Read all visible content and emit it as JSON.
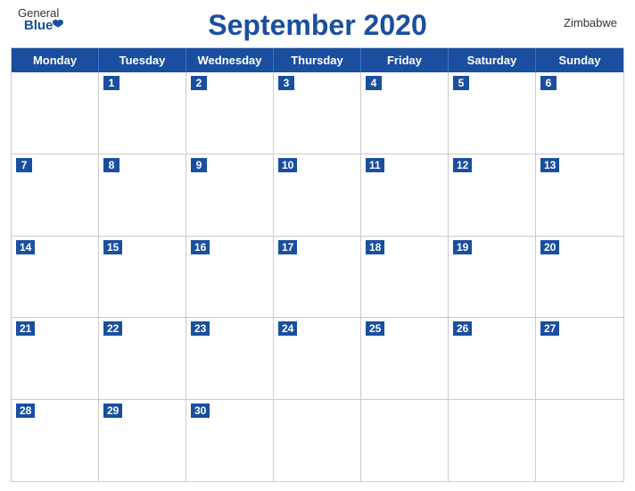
{
  "header": {
    "title": "September 2020",
    "logo_general": "General",
    "logo_blue": "Blue",
    "country": "Zimbabwe"
  },
  "days": {
    "headers": [
      "Monday",
      "Tuesday",
      "Wednesday",
      "Thursday",
      "Friday",
      "Saturday",
      "Sunday"
    ]
  },
  "weeks": [
    [
      null,
      1,
      2,
      3,
      4,
      5,
      6
    ],
    [
      7,
      8,
      9,
      10,
      11,
      12,
      13
    ],
    [
      14,
      15,
      16,
      17,
      18,
      19,
      20
    ],
    [
      21,
      22,
      23,
      24,
      25,
      26,
      27
    ],
    [
      28,
      29,
      30,
      null,
      null,
      null,
      null
    ]
  ]
}
